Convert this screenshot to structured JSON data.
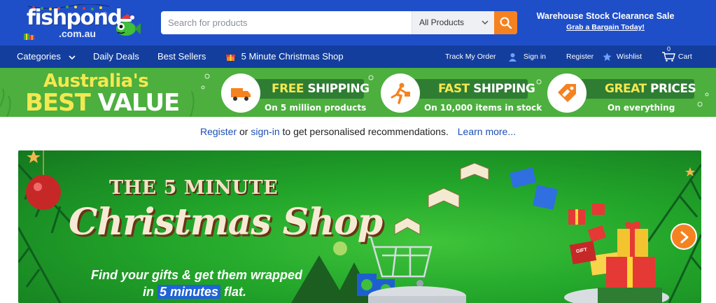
{
  "header": {
    "logo_word": "fishpond",
    "logo_reg": "®",
    "logo_sub": ".com.au",
    "search_placeholder": "Search for products",
    "search_category": "All Products",
    "promo_title": "Warehouse Stock Clearance Sale",
    "promo_link": "Grab a Bargain Today!"
  },
  "nav": {
    "categories": "Categories",
    "daily_deals": "Daily Deals",
    "best_sellers": "Best Sellers",
    "christmas_shop": "5 Minute Christmas Shop",
    "track_order": "Track My Order",
    "sign_in": "Sign in",
    "register": "Register",
    "wishlist": "Wishlist",
    "cart_count": "0",
    "cart": "Cart"
  },
  "value_banner": {
    "headline_line1": "Australia's",
    "headline_best": "BEST",
    "headline_value": "VALUE",
    "features": [
      {
        "title_highlight": "FREE",
        "title_rest": "SHIPPING",
        "subtitle": "On 5 million products",
        "icon": "truck-icon"
      },
      {
        "title_highlight": "FAST",
        "title_rest": "SHIPPING",
        "subtitle": "On 10,000 items in stock",
        "icon": "runner-icon"
      },
      {
        "title_highlight": "GREAT",
        "title_rest": "PRICES",
        "subtitle": "On everything",
        "icon": "sale-tag-icon"
      }
    ]
  },
  "recommendation": {
    "register": "Register",
    "or": " or ",
    "sign_in": "sign-in",
    "rest": " to get personalised recommendations.",
    "learn_more": "Learn more..."
  },
  "hero": {
    "line1": "THE 5 MINUTE",
    "line2": "Christmas Shop",
    "line3": "Find your gifts & get them wrapped",
    "line4_pre": "in ",
    "line4_highlight": "5 minutes",
    "line4_post": " flat.",
    "gift_tag": "GIFT"
  },
  "colors": {
    "header_blue": "#1f4fc8",
    "nav_blue": "#133e9e",
    "accent_orange": "#f58220",
    "banner_green": "#4caf3e",
    "link_blue": "#1a4fb5"
  }
}
